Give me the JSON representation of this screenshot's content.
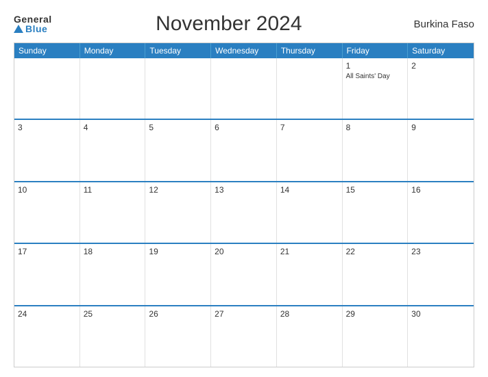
{
  "header": {
    "logo_general": "General",
    "logo_blue": "Blue",
    "title": "November 2024",
    "country": "Burkina Faso"
  },
  "day_headers": [
    "Sunday",
    "Monday",
    "Tuesday",
    "Wednesday",
    "Thursday",
    "Friday",
    "Saturday"
  ],
  "weeks": [
    {
      "days": [
        {
          "number": "",
          "events": [],
          "empty": true
        },
        {
          "number": "",
          "events": [],
          "empty": true
        },
        {
          "number": "",
          "events": [],
          "empty": true
        },
        {
          "number": "",
          "events": [],
          "empty": true
        },
        {
          "number": "",
          "events": [],
          "empty": true
        },
        {
          "number": "1",
          "events": [
            "All Saints' Day"
          ],
          "empty": false
        },
        {
          "number": "2",
          "events": [],
          "empty": false
        }
      ]
    },
    {
      "days": [
        {
          "number": "3",
          "events": [],
          "empty": false
        },
        {
          "number": "4",
          "events": [],
          "empty": false
        },
        {
          "number": "5",
          "events": [],
          "empty": false
        },
        {
          "number": "6",
          "events": [],
          "empty": false
        },
        {
          "number": "7",
          "events": [],
          "empty": false
        },
        {
          "number": "8",
          "events": [],
          "empty": false
        },
        {
          "number": "9",
          "events": [],
          "empty": false
        }
      ]
    },
    {
      "days": [
        {
          "number": "10",
          "events": [],
          "empty": false
        },
        {
          "number": "11",
          "events": [],
          "empty": false
        },
        {
          "number": "12",
          "events": [],
          "empty": false
        },
        {
          "number": "13",
          "events": [],
          "empty": false
        },
        {
          "number": "14",
          "events": [],
          "empty": false
        },
        {
          "number": "15",
          "events": [],
          "empty": false
        },
        {
          "number": "16",
          "events": [],
          "empty": false
        }
      ]
    },
    {
      "days": [
        {
          "number": "17",
          "events": [],
          "empty": false
        },
        {
          "number": "18",
          "events": [],
          "empty": false
        },
        {
          "number": "19",
          "events": [],
          "empty": false
        },
        {
          "number": "20",
          "events": [],
          "empty": false
        },
        {
          "number": "21",
          "events": [],
          "empty": false
        },
        {
          "number": "22",
          "events": [],
          "empty": false
        },
        {
          "number": "23",
          "events": [],
          "empty": false
        }
      ]
    },
    {
      "days": [
        {
          "number": "24",
          "events": [],
          "empty": false
        },
        {
          "number": "25",
          "events": [],
          "empty": false
        },
        {
          "number": "26",
          "events": [],
          "empty": false
        },
        {
          "number": "27",
          "events": [],
          "empty": false
        },
        {
          "number": "28",
          "events": [],
          "empty": false
        },
        {
          "number": "29",
          "events": [],
          "empty": false
        },
        {
          "number": "30",
          "events": [],
          "empty": false
        }
      ]
    }
  ]
}
